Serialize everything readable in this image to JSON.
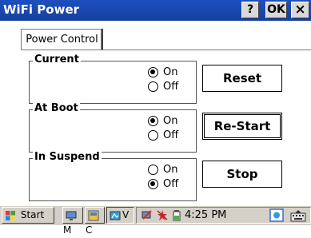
{
  "window": {
    "title": "WiFi Power",
    "help_button": "?",
    "ok_button": "OK",
    "close_button": "×"
  },
  "tabs": [
    {
      "label": "Power Control"
    }
  ],
  "groups": [
    {
      "title": "Current",
      "options": [
        {
          "label": "On",
          "selected": true
        },
        {
          "label": "Off",
          "selected": false
        }
      ]
    },
    {
      "title": "At Boot",
      "options": [
        {
          "label": "On",
          "selected": true
        },
        {
          "label": "Off",
          "selected": false
        }
      ]
    },
    {
      "title": "In Suspend",
      "options": [
        {
          "label": "On",
          "selected": false
        },
        {
          "label": "Off",
          "selected": true
        }
      ]
    }
  ],
  "buttons": {
    "reset": "Reset",
    "restart": "Re-Start",
    "stop": "Stop"
  },
  "taskbar": {
    "start_label": "Start",
    "items": [
      {
        "label": "M",
        "icon": "monitor-icon"
      },
      {
        "label": "C",
        "icon": "control-panel-icon"
      },
      {
        "label": "V",
        "icon": "view-icon"
      }
    ],
    "time": "4:25 PM"
  }
}
